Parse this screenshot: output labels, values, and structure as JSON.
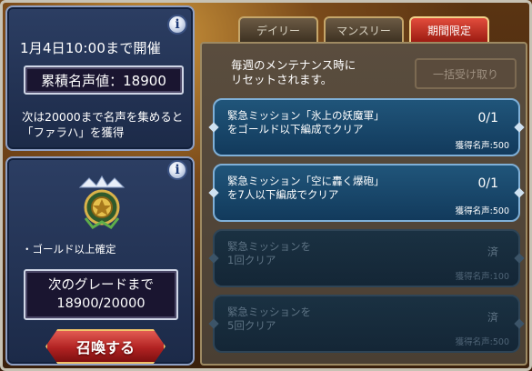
{
  "event_panel": {
    "date_text": "1月4日10:00まで開催",
    "fame_label": "累積名声値：18900",
    "note_line1": "次は20000まで名声を集めると",
    "note_line2": "「ファラハ」を獲得"
  },
  "summon_panel": {
    "guarantee_text": "・ゴールド以上確定",
    "grade_line1": "次のグレードまで",
    "grade_line2": "18900/20000",
    "summon_label": "召喚する"
  },
  "tabs": [
    {
      "label": "デイリー",
      "active": false
    },
    {
      "label": "マンスリー",
      "active": false
    },
    {
      "label": "期間限定",
      "active": true
    }
  ],
  "content": {
    "reset_line1": "毎週のメンテナンス時に",
    "reset_line2": "リセットされます。",
    "claim_all_label": "一括受け取り"
  },
  "missions": [
    {
      "title1": "緊急ミッション「氷上の妖魔軍」",
      "title2": "をゴールド以下編成でクリア",
      "progress": "0/1",
      "reward": "獲得名声:500",
      "done": false
    },
    {
      "title1": "緊急ミッション「空に轟く爆砲」",
      "title2": "を7人以下編成でクリア",
      "progress": "0/1",
      "reward": "獲得名声:500",
      "done": false
    },
    {
      "title1": "緊急ミッションを",
      "title2": "1回クリア",
      "progress": "済",
      "reward": "獲得名声:100",
      "done": true
    },
    {
      "title1": "緊急ミッションを",
      "title2": "5回クリア",
      "progress": "済",
      "reward": "獲得名声:500",
      "done": true
    }
  ],
  "icons": {
    "info": "info-icon",
    "emblem": "golden-emblem-icon"
  },
  "colors": {
    "panel_blue": "#1c2a48",
    "tab_active": "#e24c3c",
    "mission_blue": "#20557a",
    "summon_red": "#b12222"
  }
}
